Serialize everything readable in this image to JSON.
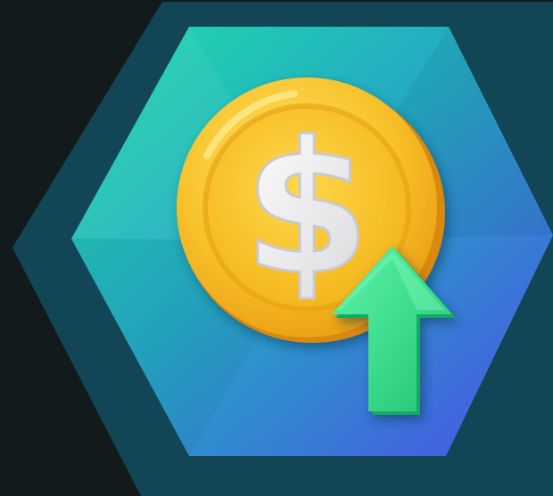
{
  "illustration": {
    "subject": "coin-price-increase-illustration",
    "coin_symbol": "$",
    "icons": [
      "dollar-coin-icon",
      "up-arrow-icon"
    ],
    "colors": {
      "page_background": "#121a1c",
      "outer_hexagon": "#124656",
      "inner_gradient_start": "#1dd3a7",
      "inner_gradient_end": "#4b55e6",
      "coin_gold": "#f7c12e",
      "coin_rim": "#e59a0c",
      "symbol": "#f4f4f4",
      "arrow": "#2fe08a"
    }
  }
}
